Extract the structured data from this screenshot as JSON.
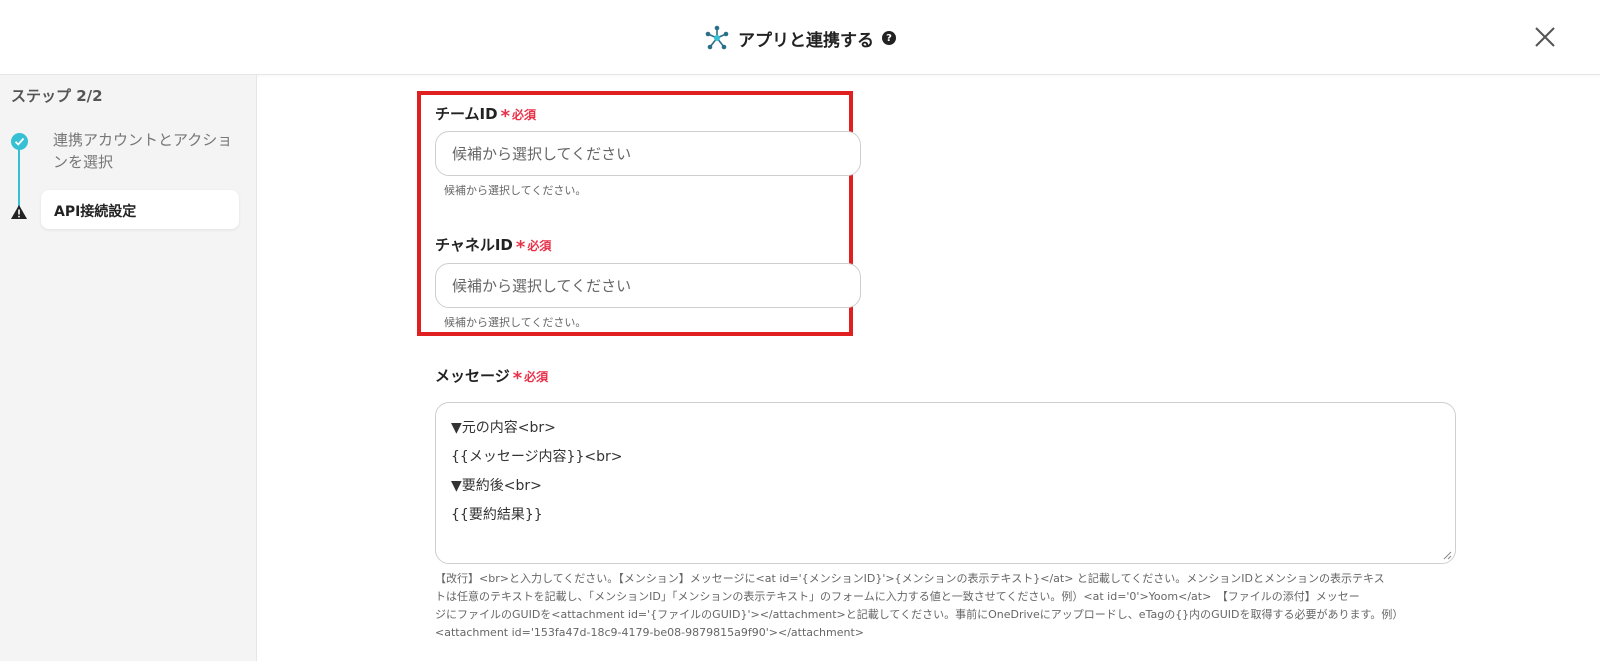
{
  "header": {
    "title": "アプリと連携する",
    "help_icon": "?",
    "app_icon": "network-nodes-icon",
    "close_icon": "close-icon"
  },
  "sidebar": {
    "step_label": "ステップ 2/2",
    "steps": [
      {
        "label": "連携アカウントとアクションを選択",
        "status": "done",
        "icon": "check-circle-icon"
      },
      {
        "label": "API接続設定",
        "status": "warning",
        "icon": "warning-icon"
      }
    ]
  },
  "form": {
    "team": {
      "label": "チームID",
      "required_mark": "*",
      "required_text": "必須",
      "placeholder": "候補から選択してください",
      "helper": "候補から選択してください。"
    },
    "channel": {
      "label": "チャネルID",
      "required_mark": "*",
      "required_text": "必須",
      "placeholder": "候補から選択してください",
      "helper": "候補から選択してください。"
    },
    "message": {
      "label": "メッセージ",
      "required_mark": "*",
      "required_text": "必須",
      "lines": [
        "▼元の内容<br>",
        "{{メッセージ内容}}<br>",
        "▼要約後<br>",
        "{{要約結果}}"
      ],
      "help_lines": [
        "【改行】<br>と入力してください。【メンション】メッセージに<at id='{メンションID}'>{メンションの表示テキスト}</at> と記載してください。メンションIDとメンションの表示テキス",
        "トは任意のテキストを記載し、「メンションID」「メンションの表示テキスト」のフォームに入力する値と一致させてください。例）<at id='0'>Yoom</at>　【ファイルの添付】メッセー",
        "ジにファイルのGUIDを<attachment id='{ファイルのGUID}'></attachment>と記載してください。事前にOneDriveにアップロードし、eTagの{}内のGUIDを取得する必要があります。例）",
        "<attachment id='153fa47d-18c9-4179-be08-9879815a9f90'></attachment>"
      ]
    }
  },
  "colors": {
    "accent": "#35c0d4",
    "required": "#e8324a",
    "highlight": "#e02020"
  }
}
